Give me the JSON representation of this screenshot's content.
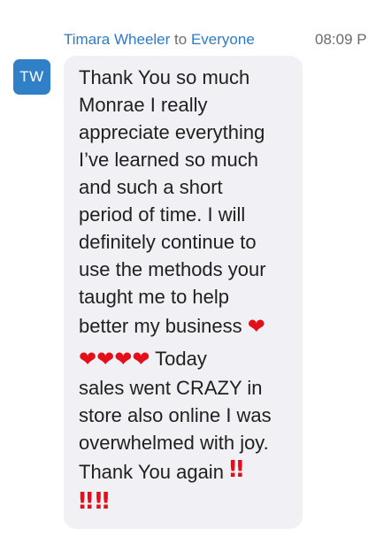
{
  "message": {
    "sender": "Timara Wheeler",
    "to_word": "to",
    "recipient": "Everyone",
    "time": "08:09 P",
    "avatar_initials": "TW",
    "lines": [
      "Thank You so much",
      "Monrae I really",
      "appreciate everything",
      "I’ve learned so much",
      "and such a short",
      "period of time. I will",
      "definitely continue to",
      "use the methods your",
      "taught me to help",
      "better my business",
      "Today",
      "sales went CRAZY in",
      "store also online I was",
      "overwhelmed with joy.",
      "Thank You again"
    ],
    "emoji": {
      "heart": "❤",
      "double_exclamation": "‼"
    },
    "colors": {
      "name_blue": "#2e7bc6",
      "avatar_blue": "#2f80c7",
      "bubble_bg": "#f1f1f5",
      "emoji_red": "#e3101a",
      "meta_gray": "#6b6b6b"
    }
  }
}
